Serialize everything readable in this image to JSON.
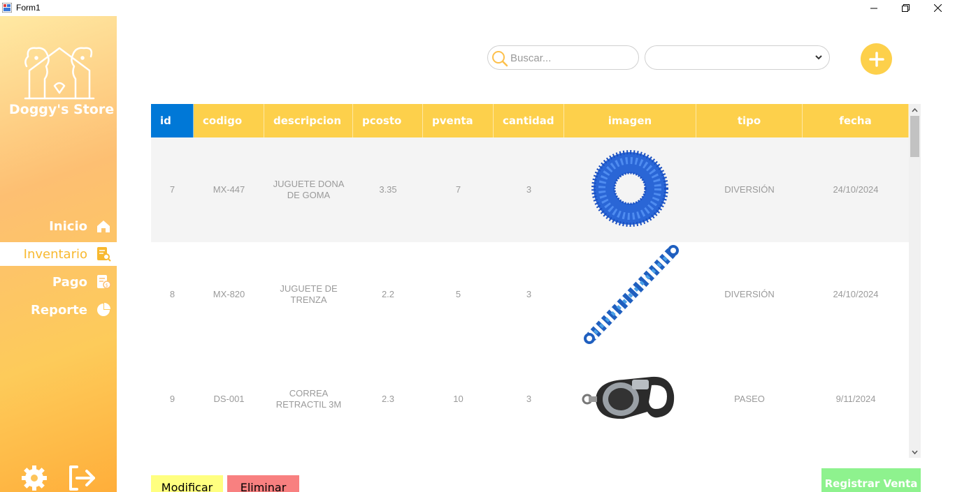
{
  "window": {
    "title": "Form1"
  },
  "sidebar": {
    "brand": "Doggy's Store",
    "nav": [
      {
        "label": "Inicio",
        "icon": "home-icon",
        "active": false
      },
      {
        "label": "Inventario",
        "icon": "inventory-icon",
        "active": true
      },
      {
        "label": "Pago",
        "icon": "payment-icon",
        "active": false
      },
      {
        "label": "Reporte",
        "icon": "pie-chart-icon",
        "active": false
      }
    ],
    "bottom_icons": [
      "gear-icon",
      "logout-icon"
    ]
  },
  "search": {
    "placeholder": "Buscar..."
  },
  "filter_combo": {
    "value": ""
  },
  "grid": {
    "columns": [
      "id",
      "codigo",
      "descripcion",
      "pcosto",
      "pventa",
      "cantidad",
      "imagen",
      "tipo",
      "fecha"
    ],
    "rows": [
      {
        "id": "7",
        "codigo": "MX-447",
        "descripcion": "JUGUETE DONA DE GOMA",
        "pcosto": "3.35",
        "pventa": "7",
        "cantidad": "3",
        "imagen": "blue-ring-toy",
        "tipo": "DIVERSIÓN",
        "fecha": "24/10/2024"
      },
      {
        "id": "8",
        "codigo": "MX-820",
        "descripcion": "JUGUETE DE TRENZA",
        "pcosto": "2.2",
        "pventa": "5",
        "cantidad": "3",
        "imagen": "rope-toy",
        "tipo": "DIVERSIÓN",
        "fecha": "24/10/2024"
      },
      {
        "id": "9",
        "codigo": "DS-001",
        "descripcion": "CORREA RETRACTIL 3M",
        "pcosto": "2.3",
        "pventa": "10",
        "cantidad": "3",
        "imagen": "retractable-leash",
        "tipo": "PASEO",
        "fecha": "9/11/2024"
      }
    ]
  },
  "buttons": {
    "modify": "Modificar",
    "delete": "Eliminar",
    "register_sale": "Registrar Venta"
  },
  "colors": {
    "accent": "#fdd04b",
    "selected_header": "#0078d7",
    "modify": "#ffff80",
    "delete": "#f88080",
    "register": "#8ef28e"
  }
}
